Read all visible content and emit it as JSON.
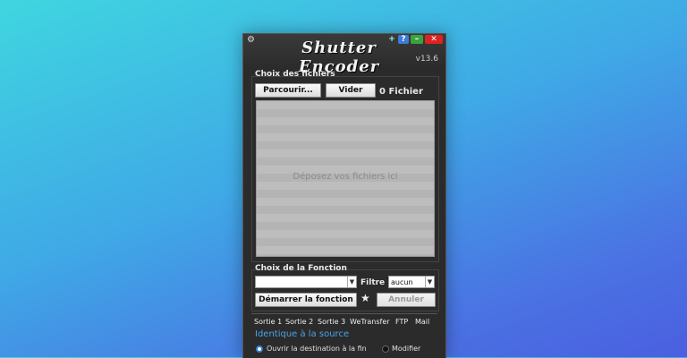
{
  "window": {
    "title": "Shutter Encoder",
    "version": "v13.6"
  },
  "titlebar": {
    "plus_icon": "+",
    "help_icon": "?",
    "minimize_icon": "–",
    "close_icon": "✕",
    "gear_icon": "⚙"
  },
  "files": {
    "group_label": "Choix des fichiers",
    "browse_label": "Parcourir...",
    "clear_label": "Vider",
    "count": "0 Fichier",
    "drop_text": "Déposez vos fichiers ici"
  },
  "function": {
    "group_label": "Choix de la Fonction",
    "function_select_value": "",
    "filter_label": "Filtre :",
    "filter_select_value": "aucun",
    "start_label": "Démarrer la fonction",
    "favorite_icon": "★",
    "cancel_label": "Annuler"
  },
  "tabs": [
    "Sortie 1",
    "Sortie 2",
    "Sortie 3",
    "WeTransfer",
    "FTP",
    "Mail"
  ],
  "output": {
    "destination_label": "Identique à la source",
    "open_dest_label": "Ouvrir la destination à la fin",
    "modify_label": "Modifier"
  }
}
